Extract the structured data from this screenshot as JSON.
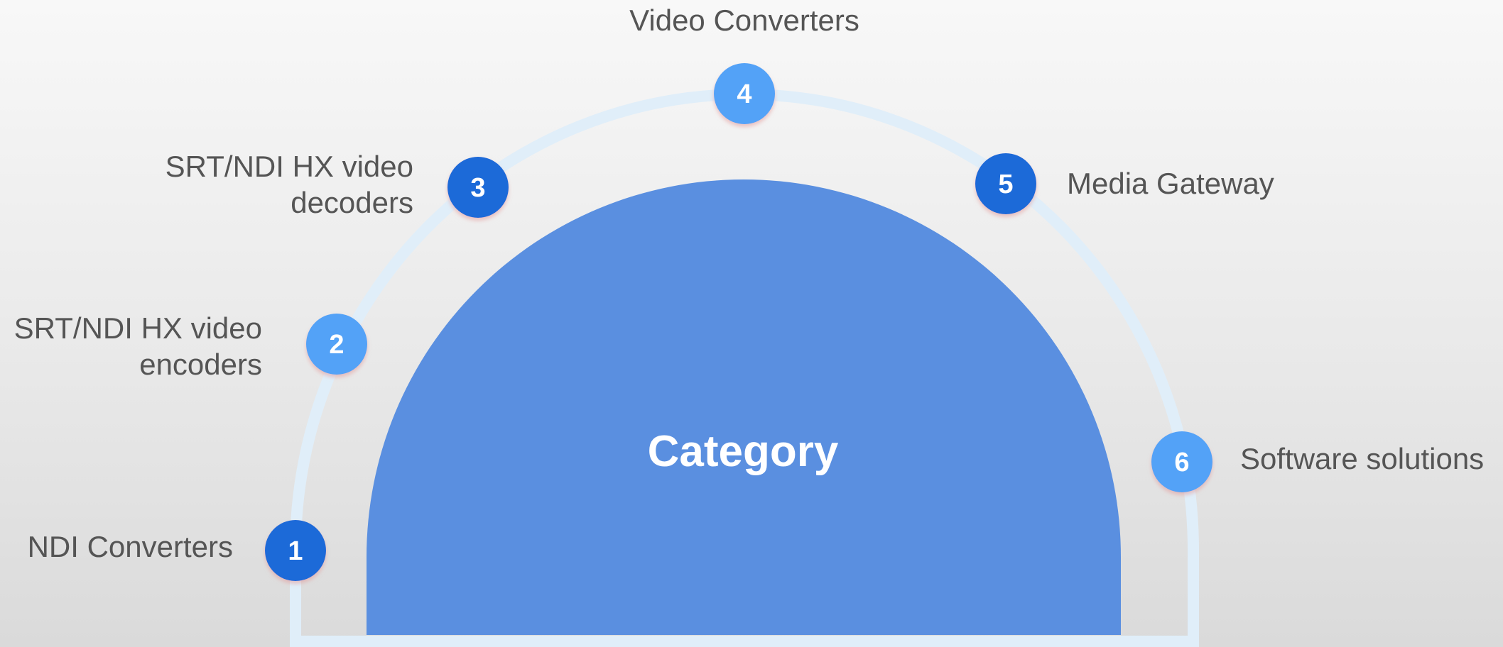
{
  "center_title": "Category",
  "colors": {
    "track": "#e0eef9",
    "center_fill": "#5a8fe0",
    "badge_dark": "#1f6ad8",
    "badge_light": "#52a2f7",
    "label_text": "#555555"
  },
  "items": [
    {
      "number": "1",
      "label": "NDI Converters",
      "badge_color": "dark"
    },
    {
      "number": "2",
      "label": "SRT/NDI HX video\nencoders",
      "badge_color": "light"
    },
    {
      "number": "3",
      "label": "SRT/NDI HX video\ndecoders",
      "badge_color": "dark"
    },
    {
      "number": "4",
      "label": "Video Converters",
      "badge_color": "light"
    },
    {
      "number": "5",
      "label": "Media Gateway",
      "badge_color": "dark"
    },
    {
      "number": "6",
      "label": "Software solutions",
      "badge_color": "light"
    }
  ]
}
